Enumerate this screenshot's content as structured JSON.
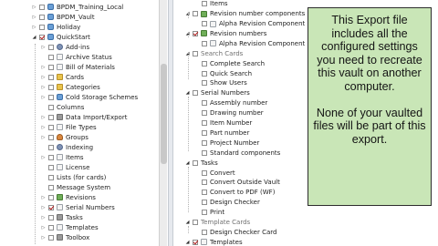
{
  "left_tree": [
    {
      "label": "BPDM_Training_Local",
      "exp": "+",
      "checked": false,
      "icon": "db",
      "dim": false
    },
    {
      "label": "BPDM_Vault",
      "exp": "+",
      "checked": false,
      "icon": "db",
      "dim": false
    },
    {
      "label": "Holiday",
      "exp": "+",
      "checked": false,
      "icon": "db",
      "dim": false
    },
    {
      "label": "QuickStart",
      "exp": "-",
      "checked": true,
      "icon": "db",
      "dim": false
    },
    {
      "label": "Add-ins",
      "exp": "+",
      "checked": false,
      "icon": "gear",
      "dim": false
    },
    {
      "label": "Archive Status",
      "exp": "",
      "checked": false,
      "icon": "doc",
      "dim": false
    },
    {
      "label": "Bill of Materials",
      "exp": "+",
      "checked": false,
      "icon": "doc",
      "dim": false
    },
    {
      "label": "Cards",
      "exp": "+",
      "checked": false,
      "icon": "folder",
      "dim": false
    },
    {
      "label": "Categories",
      "exp": "+",
      "checked": false,
      "icon": "folder",
      "dim": false
    },
    {
      "label": "Cold Storage Schemes",
      "exp": "+",
      "checked": false,
      "icon": "db",
      "dim": false
    },
    {
      "label": "Columns",
      "exp": "",
      "checked": false,
      "icon": "",
      "dim": false
    },
    {
      "label": "Data Import/Export",
      "exp": "+",
      "checked": false,
      "icon": "tool",
      "dim": false
    },
    {
      "label": "File Types",
      "exp": "+",
      "checked": false,
      "icon": "doc",
      "dim": false
    },
    {
      "label": "Groups",
      "exp": "+",
      "checked": false,
      "icon": "user",
      "dim": false
    },
    {
      "label": "Indexing",
      "exp": "",
      "checked": false,
      "icon": "gear",
      "dim": false
    },
    {
      "label": "Items",
      "exp": "+",
      "checked": false,
      "icon": "doc",
      "dim": false
    },
    {
      "label": "License",
      "exp": "",
      "checked": false,
      "icon": "doc",
      "dim": false
    },
    {
      "label": "Lists (for cards)",
      "exp": "",
      "checked": false,
      "icon": "",
      "dim": false
    },
    {
      "label": "Message System",
      "exp": "",
      "checked": false,
      "icon": "",
      "dim": false
    },
    {
      "label": "Revisions",
      "exp": "+",
      "checked": false,
      "icon": "chart",
      "dim": false
    },
    {
      "label": "Serial Numbers",
      "exp": "+",
      "checked": true,
      "icon": "doc",
      "dim": false
    },
    {
      "label": "Tasks",
      "exp": "+",
      "checked": false,
      "icon": "tool",
      "dim": false
    },
    {
      "label": "Templates",
      "exp": "+",
      "checked": false,
      "icon": "doc",
      "dim": false
    },
    {
      "label": "Toolbox",
      "exp": "+",
      "checked": false,
      "icon": "tool",
      "dim": false
    }
  ],
  "right_tree": [
    {
      "label": "Items",
      "exp": "",
      "checked": false,
      "icon": "",
      "dim": false
    },
    {
      "label": "Revision number components",
      "exp": "-",
      "checked": false,
      "icon": "chart",
      "dim": false
    },
    {
      "label": "Alpha Revision Component",
      "exp": "",
      "checked": false,
      "icon": "doc",
      "dim": false
    },
    {
      "label": "Revision numbers",
      "exp": "-",
      "checked": true,
      "icon": "chart",
      "dim": false
    },
    {
      "label": "Alpha Revision Component",
      "exp": "",
      "checked": false,
      "icon": "doc",
      "dim": false
    },
    {
      "label": "Search Cards",
      "exp": "-",
      "checked": false,
      "icon": "",
      "dim": true
    },
    {
      "label": "Complete Search",
      "exp": "",
      "checked": false,
      "icon": "",
      "dim": false
    },
    {
      "label": "Quick Search",
      "exp": "",
      "checked": false,
      "icon": "",
      "dim": false
    },
    {
      "label": "Show Users",
      "exp": "",
      "checked": false,
      "icon": "",
      "dim": false
    },
    {
      "label": "Serial Numbers",
      "exp": "-",
      "checked": false,
      "icon": "",
      "dim": false
    },
    {
      "label": "Assembly number",
      "exp": "",
      "checked": false,
      "icon": "",
      "dim": false
    },
    {
      "label": "Drawing number",
      "exp": "",
      "checked": false,
      "icon": "",
      "dim": false
    },
    {
      "label": "Item Number",
      "exp": "",
      "checked": false,
      "icon": "",
      "dim": false
    },
    {
      "label": "Part number",
      "exp": "",
      "checked": false,
      "icon": "",
      "dim": false
    },
    {
      "label": "Project Number",
      "exp": "",
      "checked": false,
      "icon": "",
      "dim": false
    },
    {
      "label": "Standard components",
      "exp": "",
      "checked": false,
      "icon": "",
      "dim": false
    },
    {
      "label": "Tasks",
      "exp": "-",
      "checked": false,
      "icon": "",
      "dim": false
    },
    {
      "label": "Convert",
      "exp": "",
      "checked": false,
      "icon": "",
      "dim": false
    },
    {
      "label": "Convert Outside Vault",
      "exp": "",
      "checked": false,
      "icon": "",
      "dim": false
    },
    {
      "label": "Convert to PDF (WF)",
      "exp": "",
      "checked": false,
      "icon": "",
      "dim": false
    },
    {
      "label": "Design Checker",
      "exp": "",
      "checked": false,
      "icon": "",
      "dim": false
    },
    {
      "label": "Print",
      "exp": "",
      "checked": false,
      "icon": "",
      "dim": false
    },
    {
      "label": "Template Cards",
      "exp": "-",
      "checked": false,
      "icon": "",
      "dim": true
    },
    {
      "label": "Design Checker Card",
      "exp": "",
      "checked": false,
      "icon": "",
      "dim": false
    },
    {
      "label": "Templates",
      "exp": "-",
      "checked": true,
      "icon": "doc",
      "dim": false
    }
  ],
  "note": {
    "paragraph_1": "This Export file includes all the configured settings you need to recreate this vault on another computer.",
    "paragraph_2": "None of your vaulted files will be part of this export."
  }
}
